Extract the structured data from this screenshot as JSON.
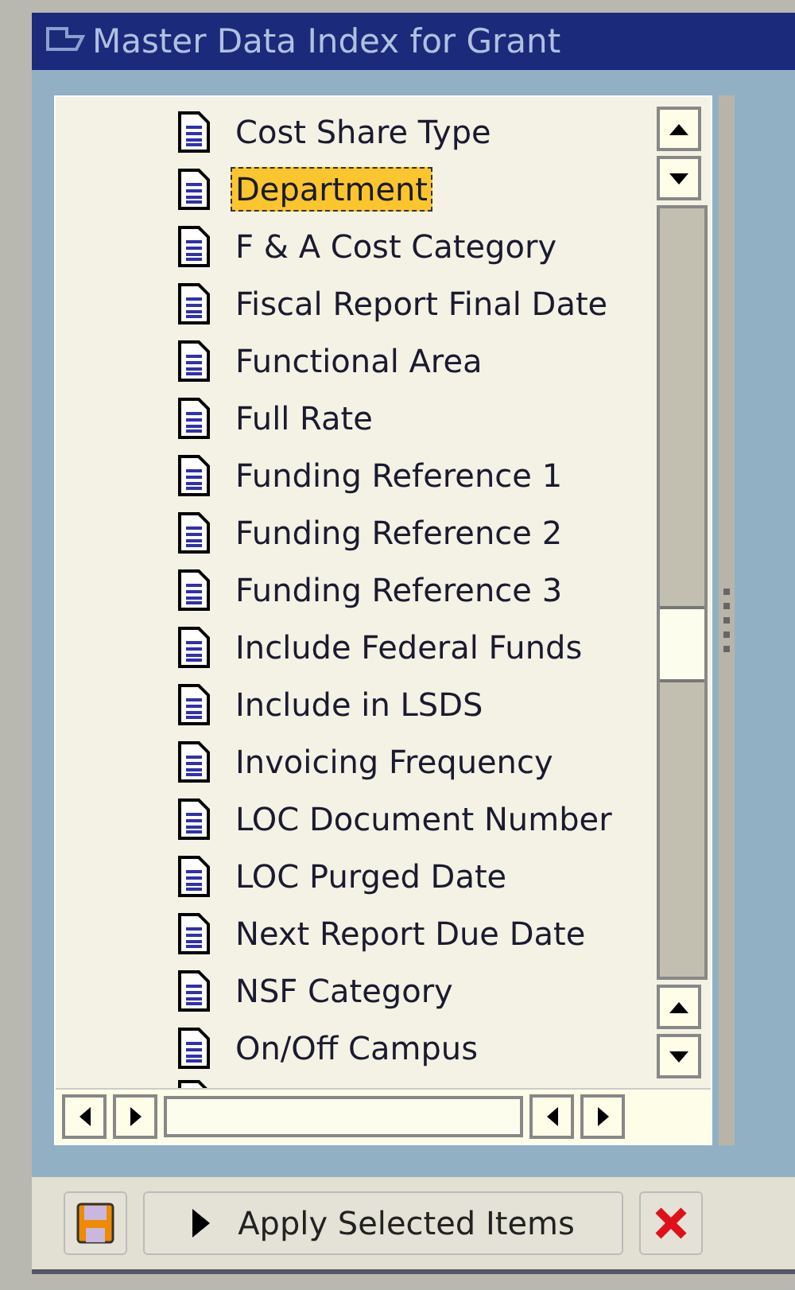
{
  "window": {
    "title": "Master Data Index for Grant"
  },
  "items": [
    {
      "label": "Cost Share Type",
      "selected": false
    },
    {
      "label": "Department",
      "selected": true
    },
    {
      "label": "F & A Cost Category",
      "selected": false
    },
    {
      "label": "Fiscal Report Final Date",
      "selected": false
    },
    {
      "label": "Functional Area",
      "selected": false
    },
    {
      "label": "Full Rate",
      "selected": false
    },
    {
      "label": "Funding Reference 1",
      "selected": false
    },
    {
      "label": "Funding Reference 2",
      "selected": false
    },
    {
      "label": "Funding Reference 3",
      "selected": false
    },
    {
      "label": "Include Federal Funds",
      "selected": false
    },
    {
      "label": "Include in LSDS",
      "selected": false
    },
    {
      "label": "Invoicing Frequency",
      "selected": false
    },
    {
      "label": "LOC Document Number",
      "selected": false
    },
    {
      "label": "LOC Purged Date",
      "selected": false
    },
    {
      "label": "Next Report Due Date",
      "selected": false
    },
    {
      "label": "NSF Category",
      "selected": false
    },
    {
      "label": "On/Off Campus",
      "selected": false
    }
  ],
  "footer": {
    "apply_button": "Apply Selected Items"
  }
}
